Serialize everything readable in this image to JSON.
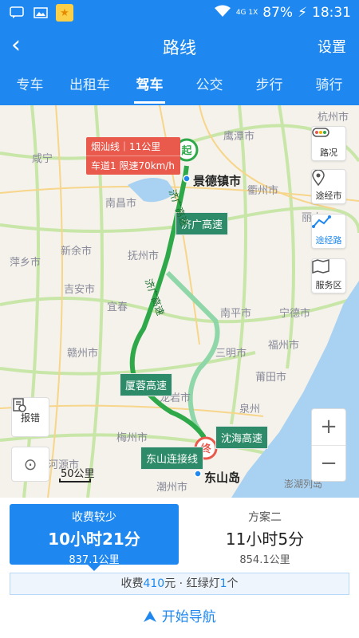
{
  "status": {
    "signal": "4G 1X",
    "battery": "87%",
    "time": "18:31"
  },
  "header": {
    "back": "‹",
    "title": "路线",
    "settings": "设置"
  },
  "tabs": [
    "专车",
    "出租车",
    "驾车",
    "公交",
    "步行",
    "骑行"
  ],
  "active_tab": "驾车",
  "map": {
    "cities": [
      "杭州市",
      "鹰潭市",
      "咸宁",
      "景德镇市",
      "南昌市",
      "衢州市",
      "丽水",
      "萍乡市",
      "新余市",
      "抚州市",
      "南平市",
      "宁德市",
      "吉安市",
      "三明市",
      "福州市",
      "赣州市",
      "龙岩市",
      "莆田市",
      "泉州",
      "梅州市",
      "河源市",
      "潮州市",
      "东山岛",
      "澎湖列岛",
      "宜春"
    ],
    "info_box": {
      "line1": "烟汕线｜11公里",
      "line2": "车道1 限速70km/h"
    },
    "route_labels": [
      "济广高速",
      "济广高速",
      "济广高速",
      "厦蓉高速",
      "沈海高速",
      "东山连接线"
    ],
    "start_marker": "起",
    "end_marker": "终",
    "end_place": "东山岛",
    "start_place": "景德镇市",
    "scale": "50公里"
  },
  "side_buttons": {
    "traffic": "路况",
    "via_city": "途经市",
    "via_road": "途经路",
    "service": "服务区",
    "zoom_in": "+",
    "zoom_out": "−",
    "report": "报错",
    "locate": "⊙"
  },
  "plans": [
    {
      "tag": "收费较少",
      "time": "10小时21分",
      "distance": "837.1公里"
    },
    {
      "tag": "方案二",
      "time": "11小时5分",
      "distance": "854.1公里"
    }
  ],
  "summary": {
    "prefix": "收费",
    "toll": "410",
    "unit": "元 · 红绿灯",
    "lights": "1",
    "suffix": "个"
  },
  "start_nav": "开始导航",
  "colors": {
    "primary": "#1e88f0",
    "route": "#2fa84a",
    "alt_route": "#8fd6a8",
    "label_bg": "#2e8b6a",
    "info_bg": "#e9594c"
  }
}
